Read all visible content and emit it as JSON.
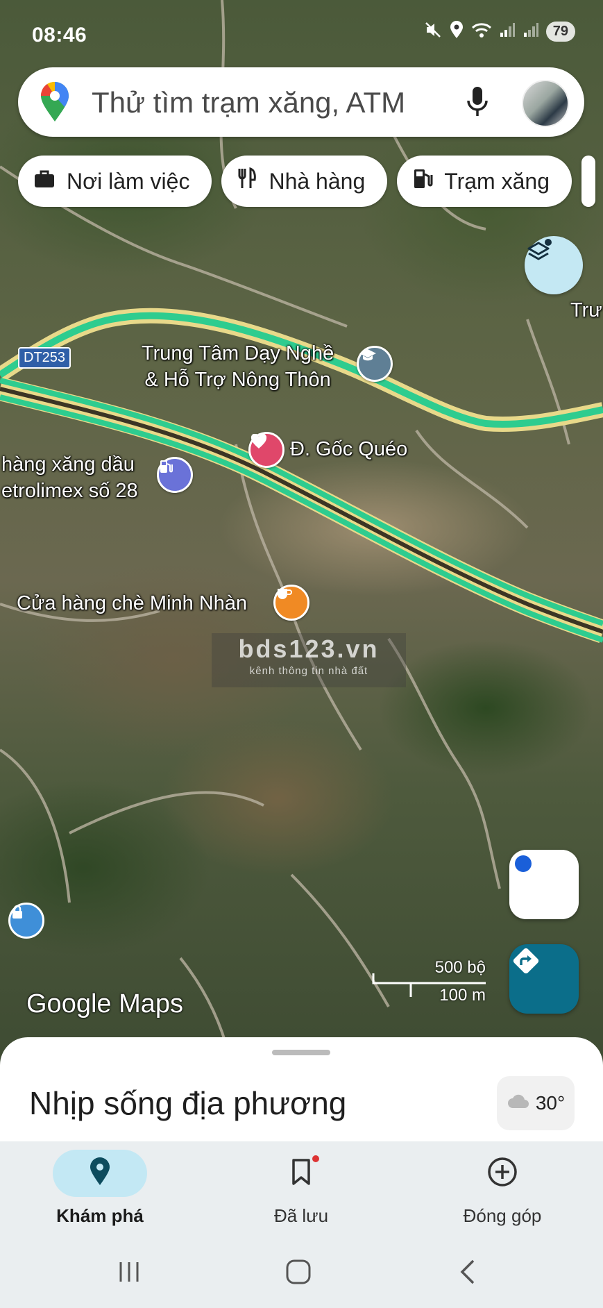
{
  "status_bar": {
    "time": "08:46",
    "battery": "79",
    "icons": [
      "mute-icon",
      "location-icon",
      "wifi-icon",
      "signal-icon",
      "signal-icon"
    ]
  },
  "search": {
    "placeholder": "Thử tìm trạm xăng, ATM"
  },
  "chips": [
    {
      "label": "Nơi làm việc",
      "icon": "briefcase-icon"
    },
    {
      "label": "Nhà hàng",
      "icon": "fork-knife-icon"
    },
    {
      "label": "Trạm xăng",
      "icon": "gas-pump-icon"
    }
  ],
  "map": {
    "road_shield": "DT253",
    "labels": {
      "vocational_center": "Trung Tâm Dạy Nghề\n& Hỗ Trợ Nông Thôn",
      "goc_queo": "Đ. Gốc Quéo",
      "petrol_line1": "hàng xăng dầu",
      "petrol_line2": "etrolimex số 28",
      "tea_shop": "Cửa hàng chè Minh Nhàn",
      "edge_right": "Trư"
    },
    "watermark": {
      "title": "bds123.vn",
      "subtitle": "kênh thông tin nhà đất"
    },
    "scale": {
      "imperial": "500 bộ",
      "metric": "100 m"
    },
    "logo": "Google Maps",
    "colors": {
      "road_green": "#2ecc8f",
      "road_yellow": "#e8d98a"
    }
  },
  "sheet": {
    "title": "Nhịp sống địa phương",
    "weather": "30°"
  },
  "bottom_nav": [
    {
      "label": "Khám phá",
      "icon": "map-pin-icon",
      "active": true
    },
    {
      "label": "Đã lưu",
      "icon": "bookmark-icon",
      "active": false
    },
    {
      "label": "Đóng góp",
      "icon": "add-circle-icon",
      "active": false
    }
  ]
}
